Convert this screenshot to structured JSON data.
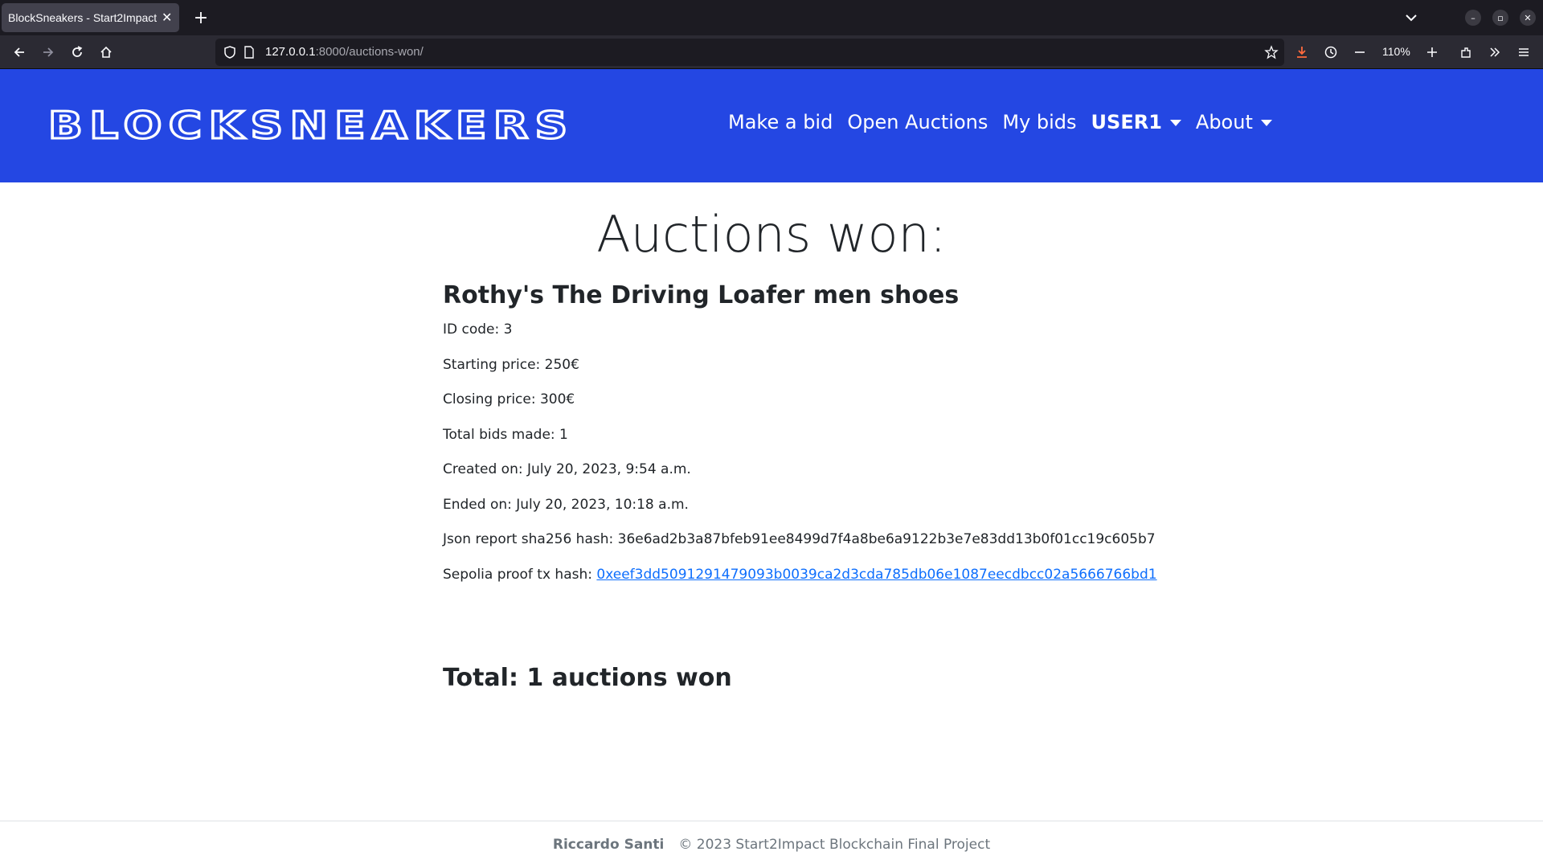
{
  "browser": {
    "tab_title": "BlockSneakers - Start2Impact",
    "tab_close": "✕",
    "new_tab": "+",
    "url_host": "127.0.0.1",
    "url_path": ":8000/auctions-won/",
    "zoom": "110%"
  },
  "header": {
    "logo": "BLOCKSNEAKERS",
    "nav": {
      "make_bid": "Make a bid",
      "open_auctions": "Open Auctions",
      "my_bids": "My bids",
      "user": "USER1",
      "about": "About"
    }
  },
  "main": {
    "title": "Auctions won:",
    "auction": {
      "name": "Rothy's The Driving Loafer men shoes",
      "id_code": "ID code: 3",
      "starting_price": "Starting price: 250€",
      "closing_price": "Closing price: 300€",
      "total_bids": "Total bids made: 1",
      "created_on": "Created on: July 20, 2023, 9:54 a.m.",
      "ended_on": "Ended on: July 20, 2023, 10:18 a.m.",
      "json_hash": "Json report sha256 hash: 36e6ad2b3a87bfeb91ee8499d7f4a8be6a9122b3e7e83dd13b0f01cc19c605b7",
      "proof_label": "Sepolia proof tx hash: ",
      "proof_hash": "0xeef3dd5091291479093b0039ca2d3cda785db06e1087eecdbcc02a5666766bd1"
    },
    "total": "Total: 1 auctions won"
  },
  "footer": {
    "author": "Riccardo Santi",
    "copyright": "© 2023 Start2Impact Blockchain Final Project"
  }
}
